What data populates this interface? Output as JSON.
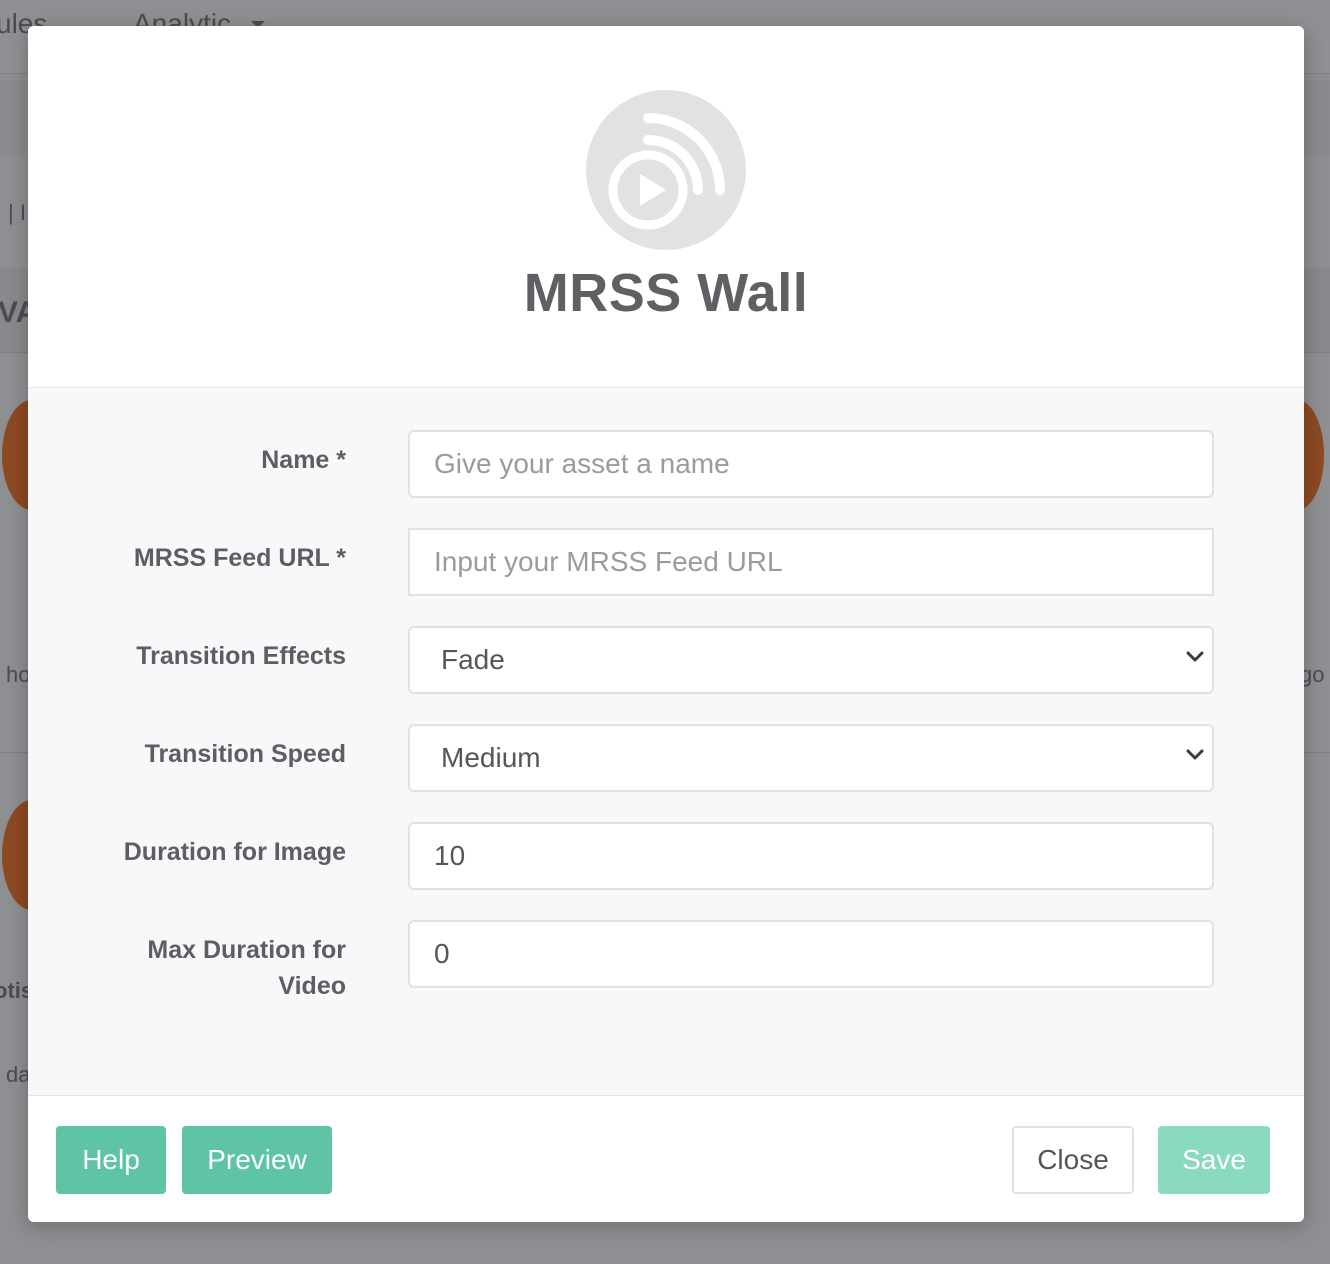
{
  "background": {
    "nav_left": "ules",
    "nav_analytic": "Analytic",
    "fragment_va": "VA",
    "fragment_ho": "ho",
    "fragment_go": "go",
    "fragment_oti": "otis",
    "fragment_da": "da",
    "fragment_pipe": "| I"
  },
  "modal": {
    "icon": "mrss-wall-icon",
    "title": "MRSS Wall",
    "form": {
      "name_label": "Name *",
      "name_placeholder": "Give your asset a name",
      "name_value": "",
      "feed_label": "MRSS Feed URL *",
      "feed_placeholder": "Input your MRSS Feed URL",
      "feed_value": "",
      "transition_effects_label": "Transition Effects",
      "transition_effects_value": "Fade",
      "transition_speed_label": "Transition Speed",
      "transition_speed_value": "Medium",
      "duration_image_label": "Duration for Image",
      "duration_image_value": "10",
      "max_duration_video_label": "Max Duration for Video",
      "max_duration_video_value": "0"
    },
    "footer": {
      "help": "Help",
      "preview": "Preview",
      "close": "Close",
      "save": "Save"
    },
    "colors": {
      "accent": "#5ec4a5",
      "accent_disabled": "#8ad9c1"
    }
  }
}
